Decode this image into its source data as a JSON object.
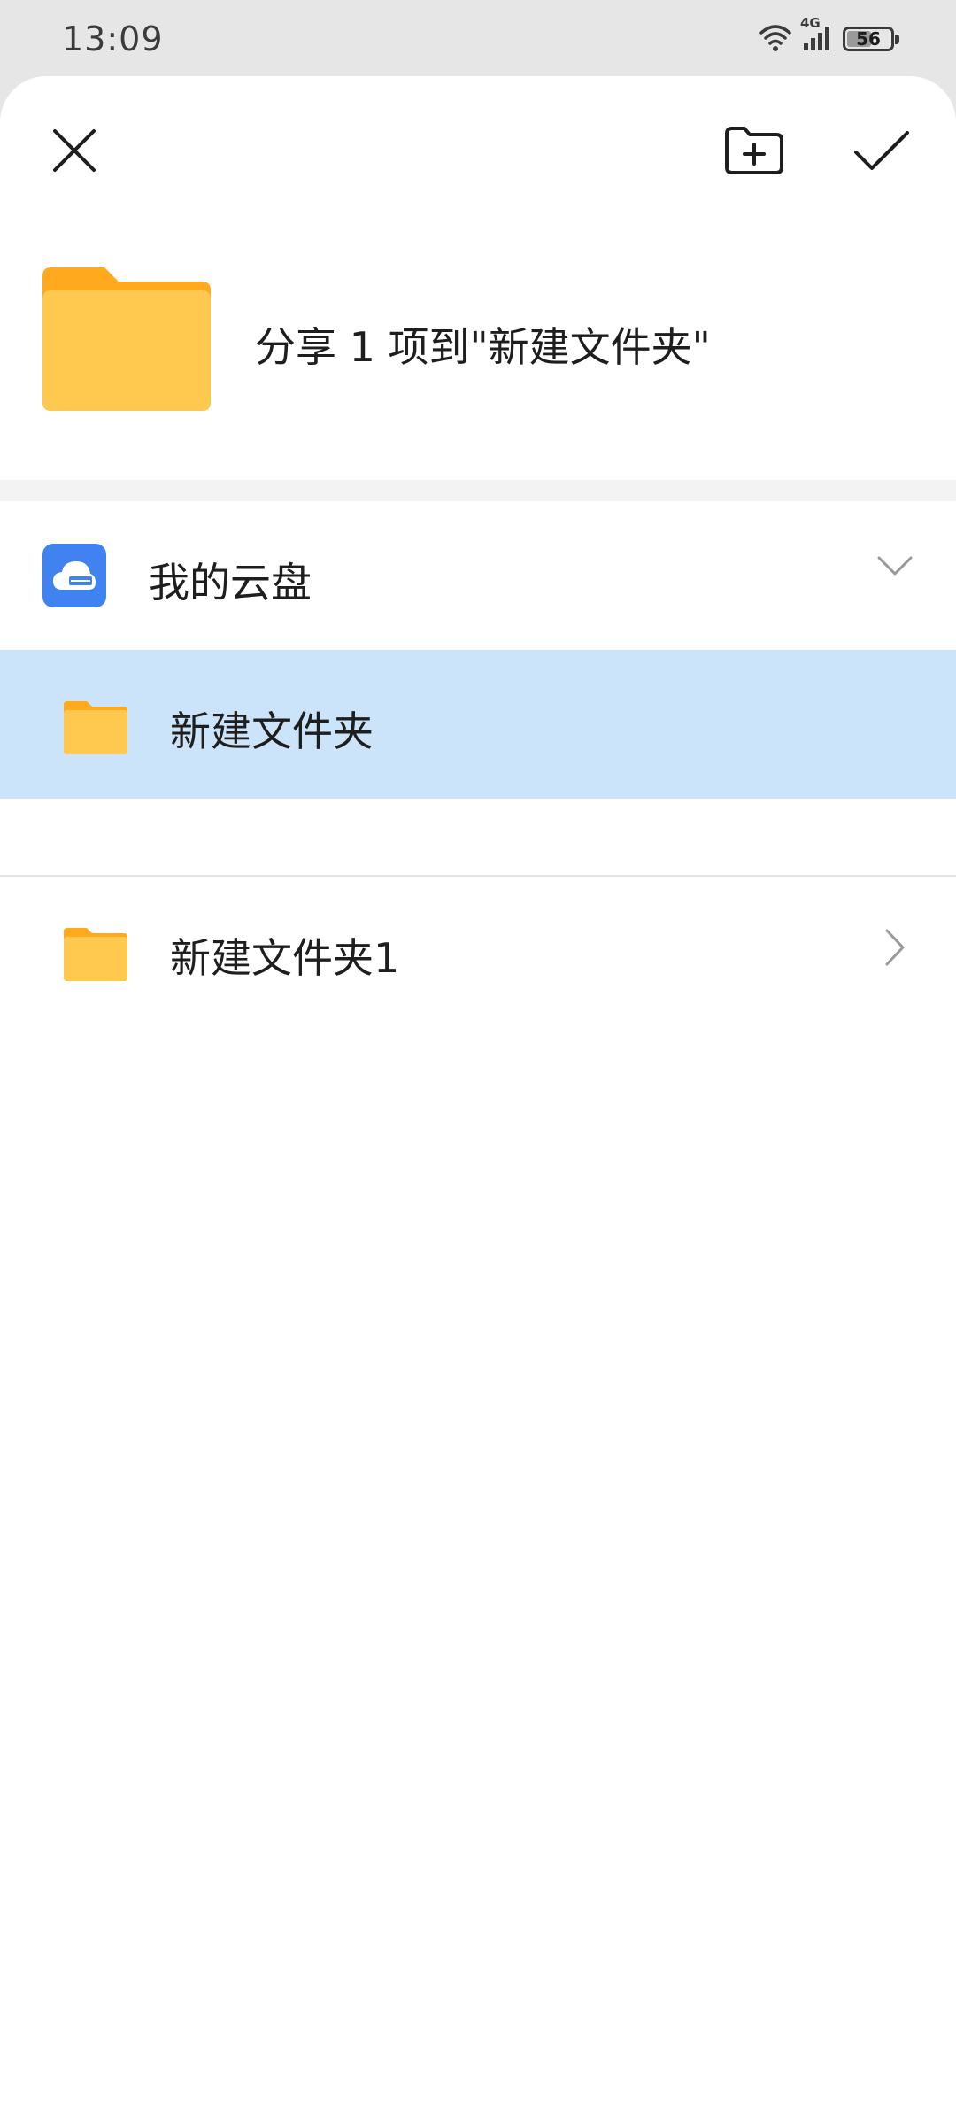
{
  "status_bar": {
    "time": "13:09",
    "network": "4G",
    "battery_percent": 56,
    "battery_text": "56"
  },
  "toolbar": {
    "close_icon": "close-icon",
    "new_folder_icon": "new-folder-icon",
    "confirm_icon": "checkmark-icon"
  },
  "share": {
    "title": "分享 1 项到\"新建文件夹\""
  },
  "drive": {
    "label": "我的云盘",
    "icon": "cloud-drive-icon",
    "expanded": true
  },
  "folders": [
    {
      "label": "新建文件夹",
      "selected": true,
      "has_children": false
    },
    {
      "label": "新建文件夹1",
      "selected": false,
      "has_children": true
    }
  ],
  "colors": {
    "accent_blue": "#3f82f0",
    "selected_row": "#cce4f9",
    "folder_yellow": "#ffc94f",
    "folder_tab": "#ffa91e"
  }
}
